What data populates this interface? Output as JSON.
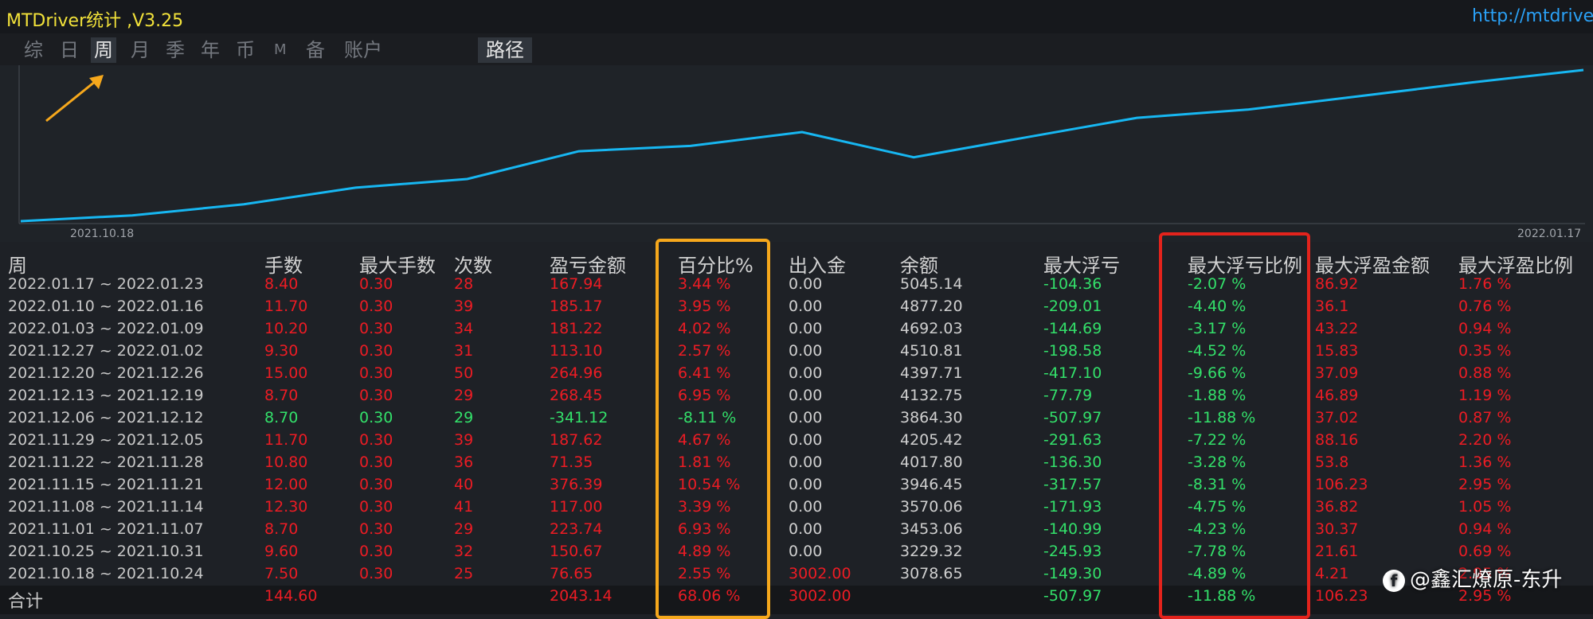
{
  "app": {
    "title": "MTDriver统计 ,V3.25",
    "url": "http://mtdriver.c"
  },
  "nav": {
    "tabs": [
      {
        "label": "综",
        "active": false
      },
      {
        "label": "日",
        "active": false
      },
      {
        "label": "周",
        "active": true
      },
      {
        "label": "月",
        "active": false
      },
      {
        "label": "季",
        "active": false
      },
      {
        "label": "年",
        "active": false
      },
      {
        "label": "币",
        "active": false
      },
      {
        "label": "M",
        "active": false
      },
      {
        "label": "备",
        "active": false
      },
      {
        "label": "账户",
        "active": false
      }
    ],
    "path_button": "路径"
  },
  "chart_data": {
    "type": "line",
    "x_start_label": "2021.10.18",
    "x_end_label": "2022.01.17",
    "x": [
      "2021.10.18",
      "2021.10.25",
      "2021.11.01",
      "2021.11.08",
      "2021.11.15",
      "2021.11.22",
      "2021.11.29",
      "2021.12.06",
      "2021.12.13",
      "2021.12.20",
      "2021.12.27",
      "2022.01.03",
      "2022.01.10",
      "2022.01.17"
    ],
    "values": [
      3000,
      3078.65,
      3229.32,
      3453.06,
      3570.06,
      3946.45,
      4017.8,
      4205.42,
      3864.3,
      4132.75,
      4397.71,
      4510.81,
      4692.03,
      4877.2,
      5045.14
    ],
    "line_color": "#17b7f2"
  },
  "table": {
    "headers": [
      "周",
      "手数",
      "最大手数",
      "次数",
      "盈亏金额",
      "百分比%",
      "出入金",
      "余额",
      "最大浮亏",
      "最大浮亏比例",
      "最大浮盈金额",
      "最大浮盈比例"
    ],
    "rows": [
      [
        "2022.01.17 ~ 2022.01.23",
        "8.40",
        "0.30",
        "28",
        "167.94",
        "3.44 %",
        "0.00",
        "5045.14",
        "-104.36",
        "-2.07 %",
        "86.92",
        "1.76 %"
      ],
      [
        "2022.01.10 ~ 2022.01.16",
        "11.70",
        "0.30",
        "39",
        "185.17",
        "3.95 %",
        "0.00",
        "4877.20",
        "-209.01",
        "-4.40 %",
        "36.1",
        "0.76 %"
      ],
      [
        "2022.01.03 ~ 2022.01.09",
        "10.20",
        "0.30",
        "34",
        "181.22",
        "4.02 %",
        "0.00",
        "4692.03",
        "-144.69",
        "-3.17 %",
        "43.22",
        "0.94 %"
      ],
      [
        "2021.12.27 ~ 2022.01.02",
        "9.30",
        "0.30",
        "31",
        "113.10",
        "2.57 %",
        "0.00",
        "4510.81",
        "-198.58",
        "-4.52 %",
        "15.83",
        "0.35 %"
      ],
      [
        "2021.12.20 ~ 2021.12.26",
        "15.00",
        "0.30",
        "50",
        "264.96",
        "6.41 %",
        "0.00",
        "4397.71",
        "-417.10",
        "-9.66 %",
        "37.09",
        "0.88 %"
      ],
      [
        "2021.12.13 ~ 2021.12.19",
        "8.70",
        "0.30",
        "29",
        "268.45",
        "6.95 %",
        "0.00",
        "4132.75",
        "-77.79",
        "-1.88 %",
        "46.89",
        "1.19 %"
      ],
      [
        "2021.12.06 ~ 2021.12.12",
        "8.70",
        "0.30",
        "29",
        "-341.12",
        "-8.11 %",
        "0.00",
        "3864.30",
        "-507.97",
        "-11.88 %",
        "37.02",
        "0.87 %"
      ],
      [
        "2021.11.29 ~ 2021.12.05",
        "11.70",
        "0.30",
        "39",
        "187.62",
        "4.67 %",
        "0.00",
        "4205.42",
        "-291.63",
        "-7.22 %",
        "88.16",
        "2.20 %"
      ],
      [
        "2021.11.22 ~ 2021.11.28",
        "10.80",
        "0.30",
        "36",
        "71.35",
        "1.81 %",
        "0.00",
        "4017.80",
        "-136.30",
        "-3.28 %",
        "53.8",
        "1.36 %"
      ],
      [
        "2021.11.15 ~ 2021.11.21",
        "12.00",
        "0.30",
        "40",
        "376.39",
        "10.54 %",
        "0.00",
        "3946.45",
        "-317.57",
        "-8.31 %",
        "106.23",
        "2.95 %"
      ],
      [
        "2021.11.08 ~ 2021.11.14",
        "12.30",
        "0.30",
        "41",
        "117.00",
        "3.39 %",
        "0.00",
        "3570.06",
        "-171.93",
        "-4.75 %",
        "36.82",
        "1.05 %"
      ],
      [
        "2021.11.01 ~ 2021.11.07",
        "8.70",
        "0.30",
        "29",
        "223.74",
        "6.93 %",
        "0.00",
        "3453.06",
        "-140.99",
        "-4.23 %",
        "30.37",
        "0.94 %"
      ],
      [
        "2021.10.25 ~ 2021.10.31",
        "9.60",
        "0.30",
        "32",
        "150.67",
        "4.89 %",
        "0.00",
        "3229.32",
        "-245.93",
        "-7.78 %",
        "21.61",
        "0.69 %"
      ],
      [
        "2021.10.18 ~ 2021.10.24",
        "7.50",
        "0.30",
        "25",
        "76.65",
        "2.55 %",
        "3002.00",
        "3078.65",
        "-149.30",
        "-4.89 %",
        "4.21",
        "2.95 %"
      ]
    ],
    "total": [
      "合计",
      "144.60",
      "",
      "",
      "2043.14",
      "68.06 %",
      "3002.00",
      "",
      "-507.97",
      "-11.88 %",
      "106.23",
      "2.95 %"
    ]
  },
  "colors": {
    "profit": "#ec1c24",
    "loss": "#33e06a",
    "neutral": "#cfcfcf",
    "highlight_orange": "#f6a81c",
    "highlight_red": "#e3231c",
    "annotation_arrow": "#f6a81c"
  },
  "watermark": {
    "icon": "facebook-icon",
    "text": "@鑫汇燎原-东升"
  }
}
